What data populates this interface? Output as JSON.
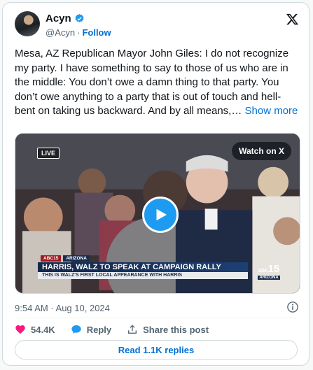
{
  "author": {
    "name": "Acyn",
    "handle": "@Acyn",
    "separator": "·",
    "follow_label": "Follow"
  },
  "tweet": {
    "text": "Mesa, AZ Republican Mayor John Giles: I do not recognize my party. I have something to say to those of us who are in the middle: You don’t owe a damn thing to that party. You don’t owe anything to a party that is out of touch and hell-bent on taking us backward. And by all means,…",
    "show_more_label": "Show more",
    "timestamp": "9:54 AM · Aug 10, 2024"
  },
  "media": {
    "live_badge": "LIVE",
    "watch_label": "Watch on X",
    "chyron_tag_1": "ABC15",
    "chyron_tag_2": "ARIZONA",
    "headline": "HARRIS, WALZ TO SPEAK AT CAMPAIGN RALLY",
    "subline": "THIS IS WALZ'S FIRST LOCAL APPEARANCE WITH HARRIS",
    "station_number": "15",
    "station_state": "ARIZONA",
    "station_brand": "abc"
  },
  "actions": {
    "likes": "54.4K",
    "reply_label": "Reply",
    "share_label": "Share this post",
    "read_replies_label": "Read 1.1K replies"
  },
  "colors": {
    "accent": "#1d9bf0",
    "link": "#006fd6",
    "like": "#f91880",
    "muted": "#536471"
  }
}
